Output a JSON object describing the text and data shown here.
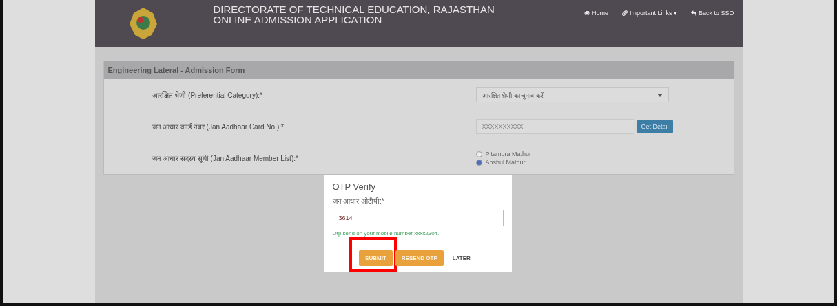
{
  "header": {
    "title_lines": [
      "DIRECTORATE OF TECHNICAL EDUCATION, RAJASTHAN",
      "ONLINE ADMISSION APPLICATION"
    ],
    "nav": [
      {
        "label": "Home"
      },
      {
        "label": "Important Links ▾"
      },
      {
        "label": "Back to SSO"
      }
    ]
  },
  "form": {
    "heading": "Engineering Lateral - Admission Form",
    "rows": [
      {
        "kind": "select",
        "label": "आरक्षित श्रेणी (Preferential Category):*",
        "value": "आरक्षित श्रेणी का चुनाव करें"
      },
      {
        "kind": "input",
        "label": "जन आधार कार्ड नंबर (Jan Aadhaar Card No.):*",
        "placeholder": "XXXXXXXXXX",
        "button": "Get Detail"
      },
      {
        "kind": "radios",
        "label": "जन आधार सदस्य सूची (Jan Aadhaar Member List):*",
        "options": [
          {
            "label": "Pitambra Mathur",
            "selected": false
          },
          {
            "label": "Anshul Mathur",
            "selected": true
          }
        ]
      }
    ]
  },
  "modal": {
    "title": "OTP Verify",
    "label": "जन आधार ओटीपी:*",
    "value": "3614",
    "message": "Otp send on your mobile number xxxx2304.",
    "buttons": [
      {
        "label": "SUBMIT",
        "kind": "primary",
        "highlighted": true
      },
      {
        "label": "RESEND OTP",
        "kind": "primary",
        "highlighted": false
      },
      {
        "label": "LATER",
        "kind": "plain",
        "highlighted": false
      }
    ]
  }
}
